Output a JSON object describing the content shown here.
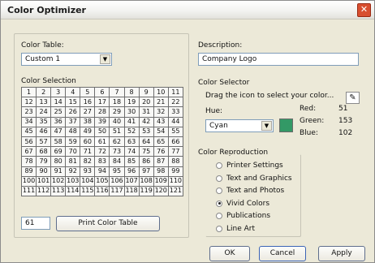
{
  "window": {
    "title": "Color Optimizer"
  },
  "color_table": {
    "label": "Color Table:",
    "value": "Custom 1"
  },
  "description": {
    "label": "Description:",
    "value": "Company Logo"
  },
  "color_selection": {
    "label": "Color Selection",
    "rows": [
      [
        "1",
        "2",
        "3",
        "4",
        "5",
        "6",
        "7",
        "8",
        "9",
        "10",
        "11"
      ],
      [
        "12",
        "13",
        "14",
        "15",
        "16",
        "17",
        "18",
        "19",
        "20",
        "21",
        "22"
      ],
      [
        "23",
        "24",
        "25",
        "26",
        "27",
        "28",
        "29",
        "30",
        "31",
        "32",
        "33"
      ],
      [
        "34",
        "35",
        "36",
        "37",
        "38",
        "39",
        "40",
        "41",
        "42",
        "43",
        "44"
      ],
      [
        "45",
        "46",
        "47",
        "48",
        "49",
        "50",
        "51",
        "52",
        "53",
        "54",
        "55"
      ],
      [
        "56",
        "57",
        "58",
        "59",
        "60",
        "61",
        "62",
        "63",
        "64",
        "65",
        "66"
      ],
      [
        "67",
        "68",
        "69",
        "70",
        "71",
        "72",
        "73",
        "74",
        "75",
        "76",
        "77"
      ],
      [
        "78",
        "79",
        "80",
        "81",
        "82",
        "83",
        "84",
        "85",
        "86",
        "87",
        "88"
      ],
      [
        "89",
        "90",
        "91",
        "92",
        "93",
        "94",
        "95",
        "96",
        "97",
        "98",
        "99"
      ],
      [
        "100",
        "101",
        "102",
        "103",
        "104",
        "105",
        "106",
        "107",
        "108",
        "109",
        "110"
      ],
      [
        "111",
        "112",
        "113",
        "114",
        "115",
        "116",
        "117",
        "118",
        "119",
        "120",
        "121"
      ]
    ],
    "selected": "61",
    "current_value": "61",
    "print_button": "Print Color Table"
  },
  "color_selector": {
    "label": "Color Selector",
    "instruction": "Drag the icon to select your color...",
    "hue_label": "Hue:",
    "hue_value": "Cyan",
    "swatch_color": "#339966",
    "red_label": "Red:",
    "red_value": "51",
    "green_label": "Green:",
    "green_value": "153",
    "blue_label": "Blue:",
    "blue_value": "102"
  },
  "color_reproduction": {
    "label": "Color Reproduction",
    "options": [
      {
        "label": "Printer Settings",
        "checked": false
      },
      {
        "label": "Text and Graphics",
        "checked": false
      },
      {
        "label": "Text and Photos",
        "checked": false
      },
      {
        "label": "Vivid Colors",
        "checked": true
      },
      {
        "label": "Publications",
        "checked": false
      },
      {
        "label": "Line Art",
        "checked": false
      }
    ]
  },
  "buttons": {
    "ok": "OK",
    "cancel": "Cancel",
    "apply": "Apply"
  },
  "icons": {
    "close": "close-icon",
    "picker": "eyedropper-icon",
    "dropdown": "chevron-down-icon"
  }
}
